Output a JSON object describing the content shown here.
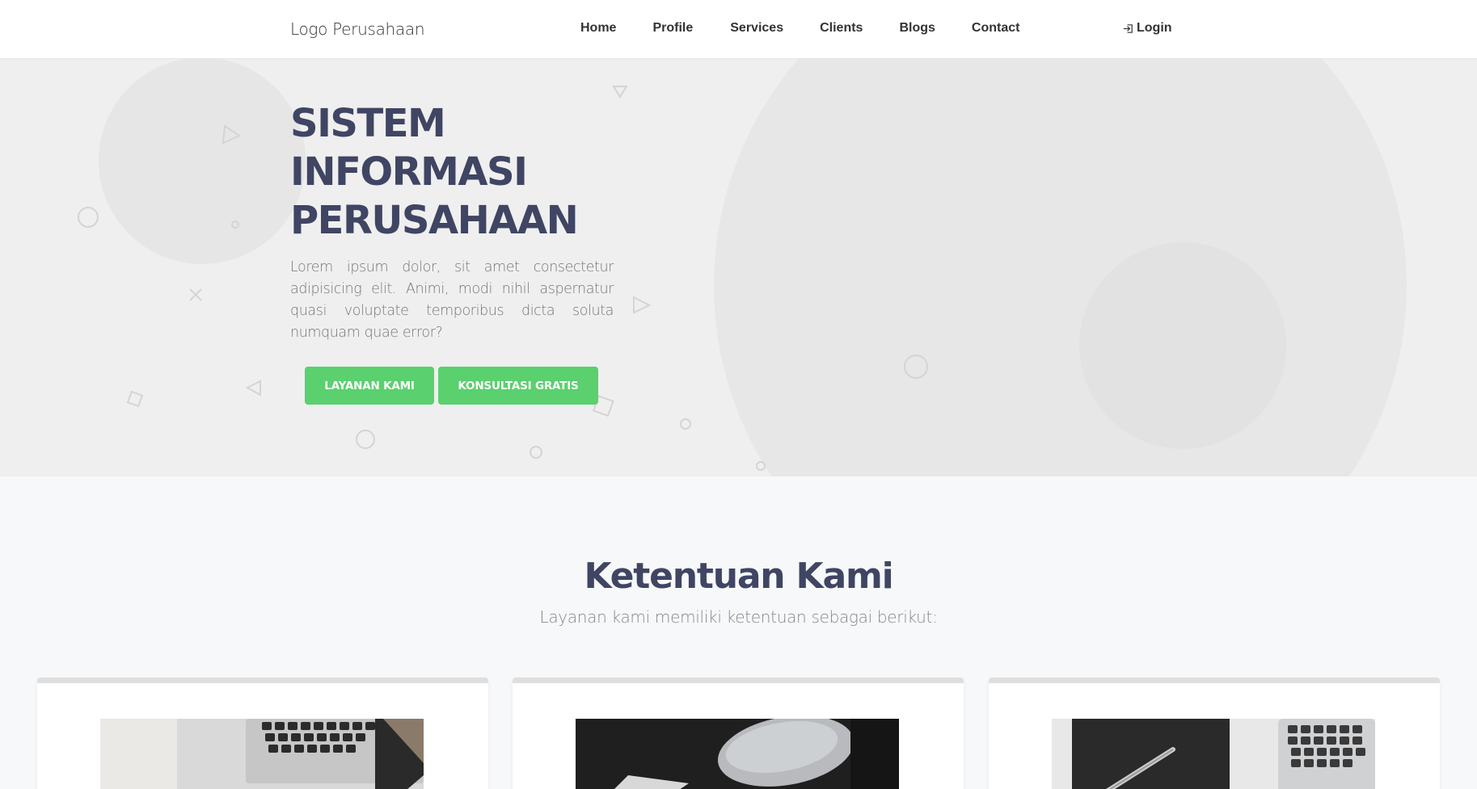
{
  "brand": "Logo Perusahaan",
  "nav": {
    "items": [
      "Home",
      "Profile",
      "Services",
      "Clients",
      "Blogs",
      "Contact"
    ],
    "login_label": "Login"
  },
  "hero": {
    "title_lines": [
      "SISTEM",
      "INFORMASI",
      "PERUSAHAAN"
    ],
    "text": "Lorem ipsum dolor, sit amet consectetur adipisicing elit. Animi, modi nihil aspernatur quasi voluptate temporibus dicta soluta numquam quae error?",
    "primary_button": "LAYANAN KAMI",
    "secondary_button": "KONSULTASI GRATIS"
  },
  "section": {
    "title": "Ketentuan Kami",
    "subtitle": "Layanan kami memiliki ketentuan sebagai berikut:"
  },
  "colors": {
    "accent_green": "#5ad06e",
    "title_navy": "#3f4563",
    "hero_bg": "#efefef"
  }
}
